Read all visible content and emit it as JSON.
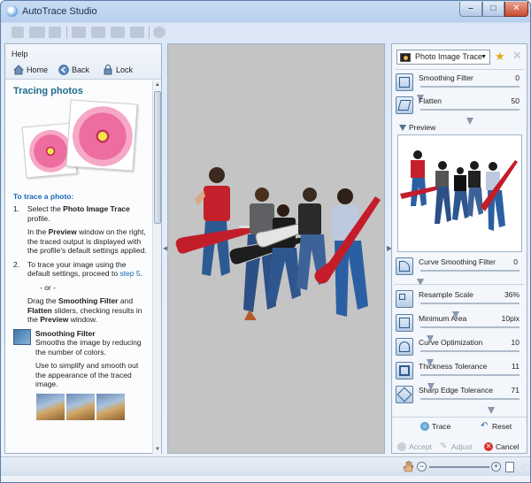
{
  "window": {
    "title": "AutoTrace Studio",
    "minimize": "–",
    "maximize": "□",
    "close": "✕"
  },
  "help": {
    "title": "Help",
    "nav": {
      "home": "Home",
      "back": "Back",
      "lock": "Lock"
    },
    "heading": "Tracing photos",
    "subheading": "To trace a photo:",
    "step1_num": "1.",
    "step1_a": "Select the ",
    "step1_bold": "Photo Image Trace",
    "step1_b": " profile.",
    "step1_detail_a": "In the ",
    "step1_detail_bold": "Preview",
    "step1_detail_b": " window on the right, the traced output is displayed with the profile's default settings applied.",
    "step2_num": "2.",
    "step2_text": "To trace your image using the default settings, proceed to ",
    "step2_link": "step 5",
    "step2_end": ".",
    "or": "- or -",
    "drag_a": "Drag the ",
    "drag_bold1": "Smoothing Filter",
    "drag_and": " and ",
    "drag_bold2": "Flatten",
    "drag_b": " sliders, checking results in the ",
    "drag_bold3": "Preview",
    "drag_c": " window.",
    "tip_title": "Smoothing Filter",
    "tip_text": "Smooths the image by reducing the number of colors.",
    "tip_more": "Use to simplify and smooth out the appearance of the traced image."
  },
  "settings": {
    "profile": "Photo Image Trace",
    "smoothing": {
      "label": "Smoothing Filter",
      "value": "0",
      "fraction": 0.0
    },
    "flatten": {
      "label": "Flatten",
      "value": "50",
      "fraction": 0.5
    },
    "preview_label": "Preview",
    "curve_smoothing": {
      "label": "Curve Smoothing Filter",
      "value": "0",
      "fraction": 0.0
    },
    "resample": {
      "label": "Resample Scale",
      "value": "36%",
      "fraction": 0.36
    },
    "min_area": {
      "label": "Minimum Area",
      "value": "10pix",
      "fraction": 0.1
    },
    "curve_opt": {
      "label": "Curve Optimization",
      "value": "10",
      "fraction": 0.1
    },
    "thickness": {
      "label": "Thickness Tolerance",
      "value": "11",
      "fraction": 0.11
    },
    "sharp_edge": {
      "label": "Sharp Edge Tolerance",
      "value": "71",
      "fraction": 0.71
    }
  },
  "actions": {
    "trace": "Trace",
    "reset": "Reset",
    "accept": "Accept",
    "adjust": "Adjust",
    "cancel": "Cancel"
  },
  "colors": {
    "accent": "#1d6b8a",
    "link": "#1668b3",
    "canvas": "#c4c4c4"
  }
}
